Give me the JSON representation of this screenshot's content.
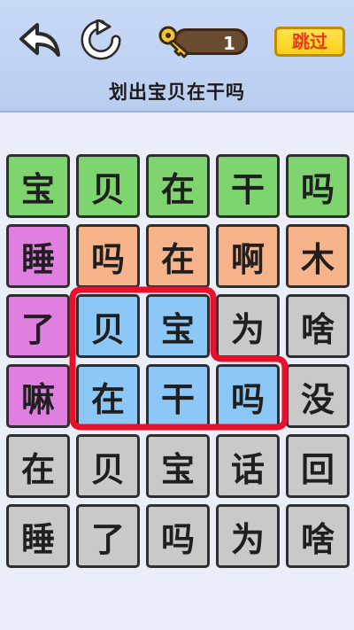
{
  "header": {
    "key_count": "1",
    "skip_label": "跳过",
    "instruction": "划出宝贝在干吗"
  },
  "icons": {
    "back": "undo-arrow-icon",
    "refresh": "refresh-icon",
    "key": "key-icon"
  },
  "colors": {
    "green": "#7ed46e",
    "pink": "#e07fe0",
    "orange": "#f7b48a",
    "blue": "#8cc8f7",
    "gray": "#c9c9c9",
    "selection": "#e8102a"
  },
  "grid": {
    "rows": [
      [
        {
          "ch": "宝",
          "color": "green"
        },
        {
          "ch": "贝",
          "color": "green"
        },
        {
          "ch": "在",
          "color": "green"
        },
        {
          "ch": "干",
          "color": "green"
        },
        {
          "ch": "吗",
          "color": "green"
        }
      ],
      [
        {
          "ch": "睡",
          "color": "pink"
        },
        {
          "ch": "吗",
          "color": "orange"
        },
        {
          "ch": "在",
          "color": "orange"
        },
        {
          "ch": "啊",
          "color": "orange"
        },
        {
          "ch": "木",
          "color": "orange"
        }
      ],
      [
        {
          "ch": "了",
          "color": "pink"
        },
        {
          "ch": "贝",
          "color": "blue"
        },
        {
          "ch": "宝",
          "color": "blue"
        },
        {
          "ch": "为",
          "color": "gray"
        },
        {
          "ch": "啥",
          "color": "gray"
        }
      ],
      [
        {
          "ch": "嘛",
          "color": "pink"
        },
        {
          "ch": "在",
          "color": "blue"
        },
        {
          "ch": "干",
          "color": "blue"
        },
        {
          "ch": "吗",
          "color": "blue"
        },
        {
          "ch": "没",
          "color": "gray"
        }
      ],
      [
        {
          "ch": "在",
          "color": "gray"
        },
        {
          "ch": "贝",
          "color": "gray"
        },
        {
          "ch": "宝",
          "color": "gray"
        },
        {
          "ch": "话",
          "color": "gray"
        },
        {
          "ch": "回",
          "color": "gray"
        }
      ],
      [
        {
          "ch": "睡",
          "color": "gray"
        },
        {
          "ch": "了",
          "color": "gray"
        },
        {
          "ch": "吗",
          "color": "gray"
        },
        {
          "ch": "为",
          "color": "gray"
        },
        {
          "ch": "啥",
          "color": "gray"
        }
      ]
    ]
  }
}
